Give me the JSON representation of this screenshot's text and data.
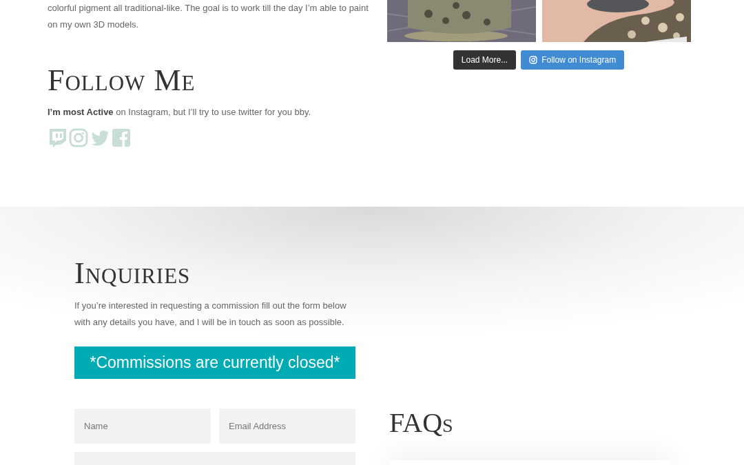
{
  "about": {
    "paragraph_lines": [
      "colorful pigment all traditional-like. The goal is to work till the day I’m able to paint",
      "on my own 3D models."
    ]
  },
  "instagram_feed": {
    "buttons": [
      {
        "label": "Load More...",
        "kind": "dark"
      },
      {
        "label": "Follow on Instagram",
        "kind": "instagram"
      }
    ]
  },
  "follow": {
    "heading": "Follow Me",
    "text": "**I’m most Active** on Instagram, but I’ll try to use twitter for you bby.",
    "social_icons": [
      {
        "kind": "twitch"
      },
      {
        "kind": "instagram"
      },
      {
        "kind": "twitter"
      },
      {
        "kind": "facebook"
      }
    ]
  },
  "inquiries": {
    "heading": "Inquiries",
    "text": "If you’re interested in requesting a commission fill out the form below with any details you have, and I will be in touch as soon as possible.",
    "notice": "*Commissions are currently closed*",
    "form": {
      "fields": [
        {
          "placeholder": "Name",
          "kind": "input"
        },
        {
          "placeholder": "Email Address",
          "kind": "input"
        },
        {
          "kind": "textarea"
        }
      ]
    }
  },
  "faqs": {
    "heading": "FAQs"
  }
}
